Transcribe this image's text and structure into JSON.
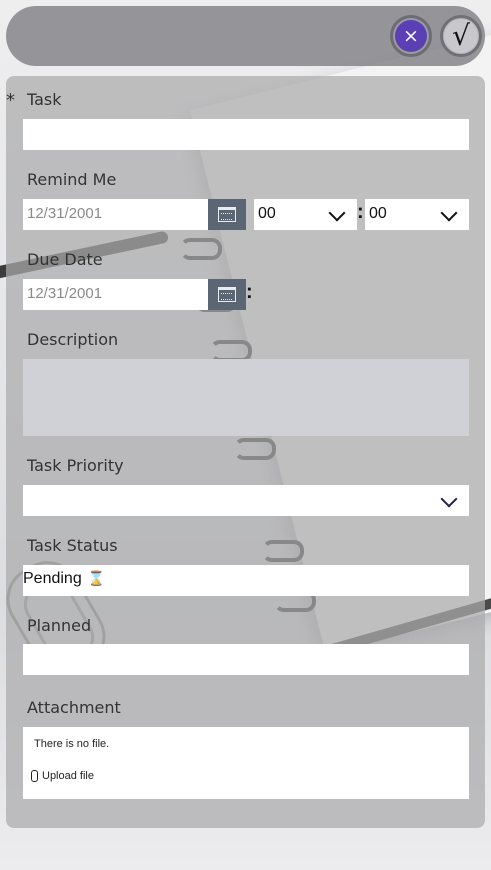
{
  "header": {
    "cancel_icon": "close-icon",
    "submit_icon": "checkmark-icon",
    "cancel_symbol": "×",
    "submit_symbol": "√",
    "accent_color": "#5b3fb5"
  },
  "form": {
    "required_mark": "*",
    "task": {
      "label": "Task",
      "value": ""
    },
    "remind_me": {
      "label": "Remind Me",
      "date": "12/31/2001",
      "hour": "00",
      "minute": "00",
      "separator": ":"
    },
    "due_date": {
      "label": "Due Date",
      "date": "12/31/2001",
      "separator": ":"
    },
    "description": {
      "label": "Description",
      "value": ""
    },
    "priority": {
      "label": "Task Priority",
      "value": ""
    },
    "status": {
      "label": "Task Status",
      "value": "Pending",
      "icon": "hourglass-icon",
      "icon_glyph": "⌛"
    },
    "planned": {
      "label": "Planned",
      "value": ""
    },
    "attachment": {
      "label": "Attachment",
      "empty_text": "There is no file.",
      "upload_label": "Upload file",
      "upload_icon": "paperclip-icon"
    }
  }
}
